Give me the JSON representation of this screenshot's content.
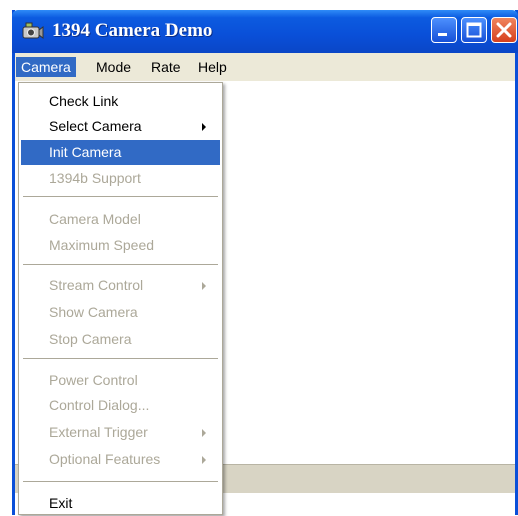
{
  "window": {
    "title": "1394 Camera Demo",
    "icon": "camera-app-icon",
    "controls": {
      "minimize": "minimize-icon",
      "maximize": "maximize-icon",
      "close": "close-icon"
    },
    "accent_color": "#0A4FD8"
  },
  "menubar": {
    "items": [
      {
        "label": "Camera",
        "active": true
      },
      {
        "label": "Mode",
        "active": false
      },
      {
        "label": "Rate",
        "active": false
      },
      {
        "label": "Help",
        "active": false
      }
    ]
  },
  "camera_menu": {
    "items": [
      {
        "label": "Check Link",
        "enabled": true
      },
      {
        "label": "Select Camera",
        "enabled": true,
        "submenu": true
      },
      {
        "label": "Init Camera",
        "enabled": true,
        "selected": true
      },
      {
        "label": "1394b Support",
        "enabled": false
      },
      {
        "label": "Camera Model",
        "enabled": false
      },
      {
        "label": "Maximum Speed",
        "enabled": false
      },
      {
        "label": "Stream Control",
        "enabled": false,
        "submenu": true
      },
      {
        "label": "Show Camera",
        "enabled": false
      },
      {
        "label": "Stop Camera",
        "enabled": false
      },
      {
        "label": "Power Control",
        "enabled": false
      },
      {
        "label": "Control Dialog...",
        "enabled": false
      },
      {
        "label": "External Trigger",
        "enabled": false,
        "submenu": true
      },
      {
        "label": "Optional Features",
        "enabled": false,
        "submenu": true
      },
      {
        "label": "Exit",
        "enabled": true
      }
    ],
    "selection_color": "#316AC5"
  }
}
